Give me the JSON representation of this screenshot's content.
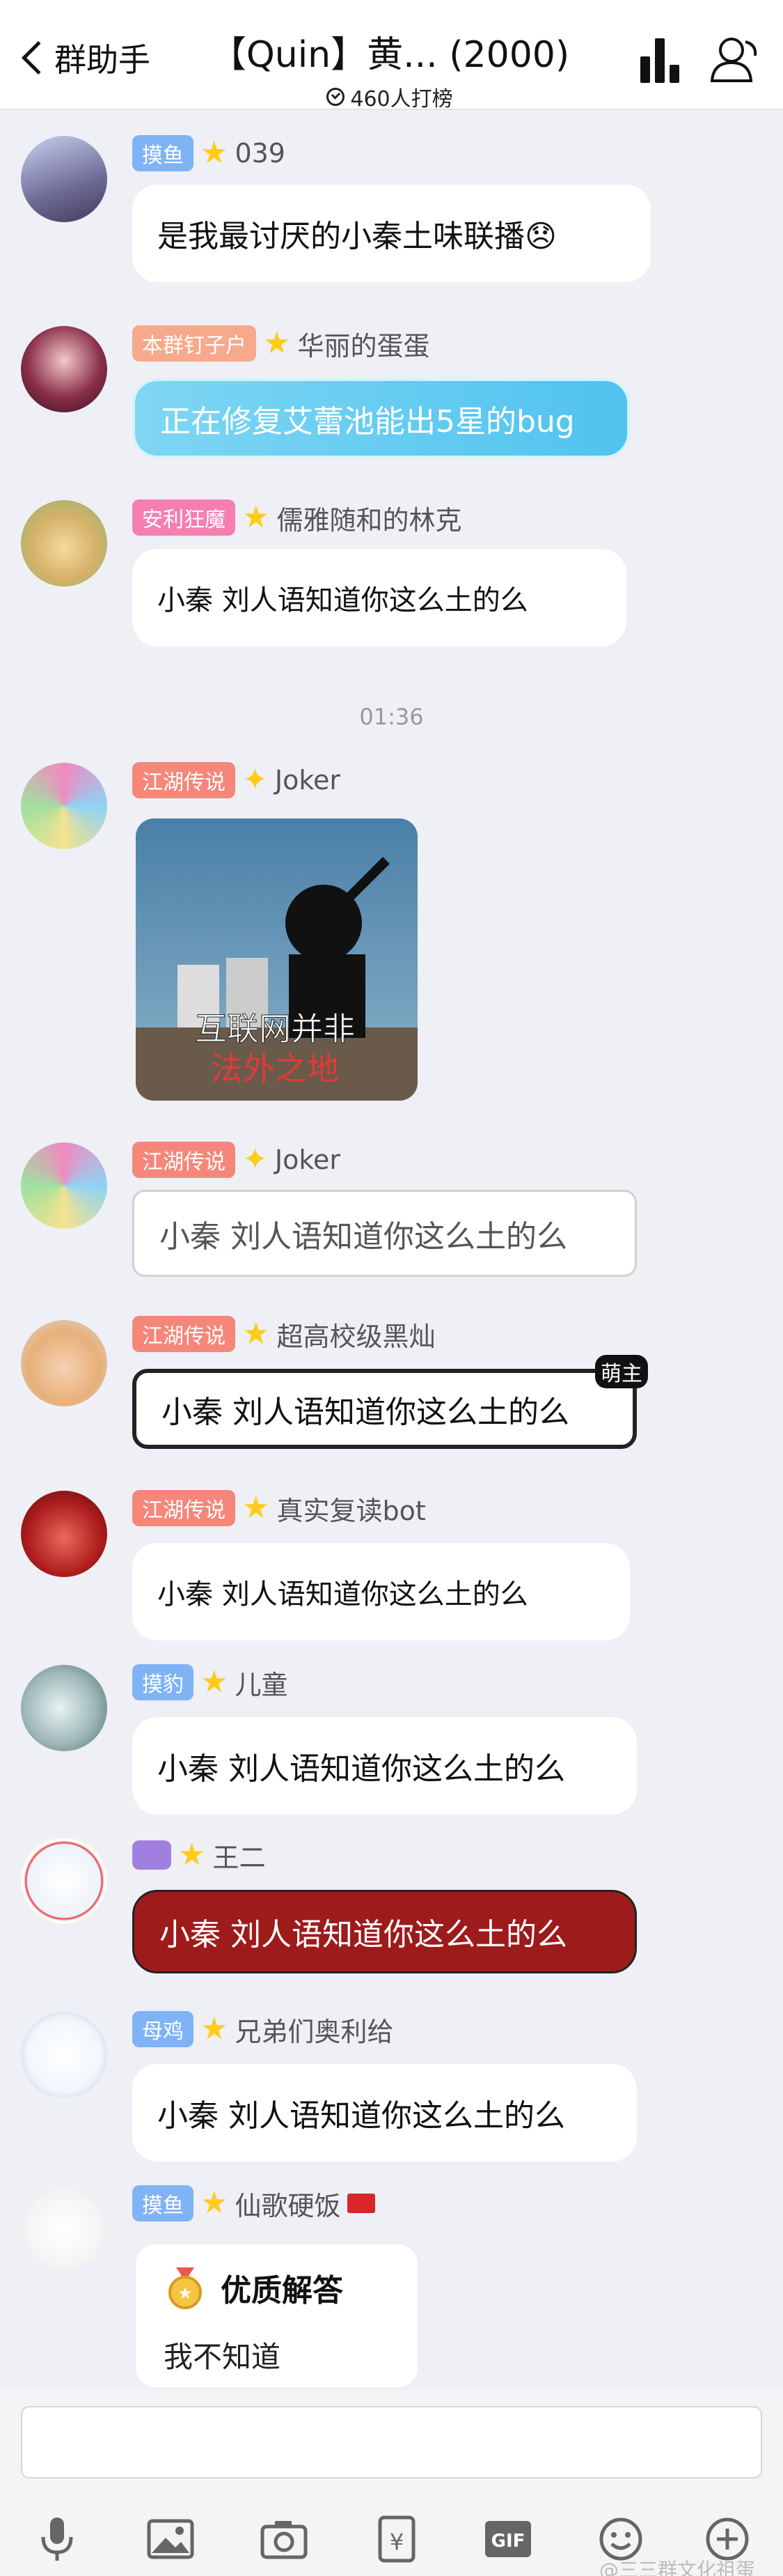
{
  "header": {
    "back_label": "群助手",
    "title": "【Quin】黄... (2000)",
    "subtitle": "460人打榜"
  },
  "time_divider": "01:36",
  "messages": [
    {
      "badge": "摸鱼",
      "badge_color": "#7fb3f5",
      "name": "039",
      "text": "是我最讨厌的小秦土味联播😞"
    },
    {
      "badge": "本群钉子户",
      "badge_color": "#f7a98c",
      "name": "华丽的蛋蛋",
      "text": "正在修复艾蕾池能出5星的bug"
    },
    {
      "badge": "安利狂魔",
      "badge_color": "#f57fb0",
      "name": "儒雅随和的林克",
      "text": "小秦 刘人语知道你这么土的么"
    },
    {
      "badge": "江湖传说",
      "badge_color": "#f5867a",
      "name": "Joker",
      "image_caption_1": "互联网并非",
      "image_caption_2": "法外之地"
    },
    {
      "badge": "江湖传说",
      "badge_color": "#f5867a",
      "name": "Joker",
      "text": "小秦 刘人语知道你这么土的么"
    },
    {
      "badge": "江湖传说",
      "badge_color": "#f5867a",
      "name": "超高校级黑灿",
      "text": "小秦 刘人语知道你这么土的么",
      "decor": "萌主"
    },
    {
      "badge": "江湖传说",
      "badge_color": "#f5867a",
      "name": "真实复读bot",
      "text": "小秦 刘人语知道你这么土的么"
    },
    {
      "badge": "摸豹",
      "badge_color": "#7fb3f5",
      "name": "儿童",
      "text": "小秦 刘人语知道你这么土的么"
    },
    {
      "badge": "",
      "badge_color": "#a17fe0",
      "name": "王二",
      "text": "小秦 刘人语知道你这么土的么"
    },
    {
      "badge": "母鸡",
      "badge_color": "#7fb3f5",
      "name": "兄弟们奥利给",
      "text": "小秦 刘人语知道你这么土的么"
    },
    {
      "badge": "摸鱼",
      "badge_color": "#7fb3f5",
      "name": "仙歌硬饭",
      "card_title": "优质解答",
      "card_body": "我不知道"
    }
  ],
  "toolbar": {
    "icons": [
      "microphone-icon",
      "image-icon",
      "camera-icon",
      "red-packet-icon",
      "gif-icon",
      "emoji-icon",
      "plus-icon"
    ],
    "gif_label": "GIF",
    "yen_label": "¥"
  },
  "watermark": "@三三群文化祖蛋"
}
